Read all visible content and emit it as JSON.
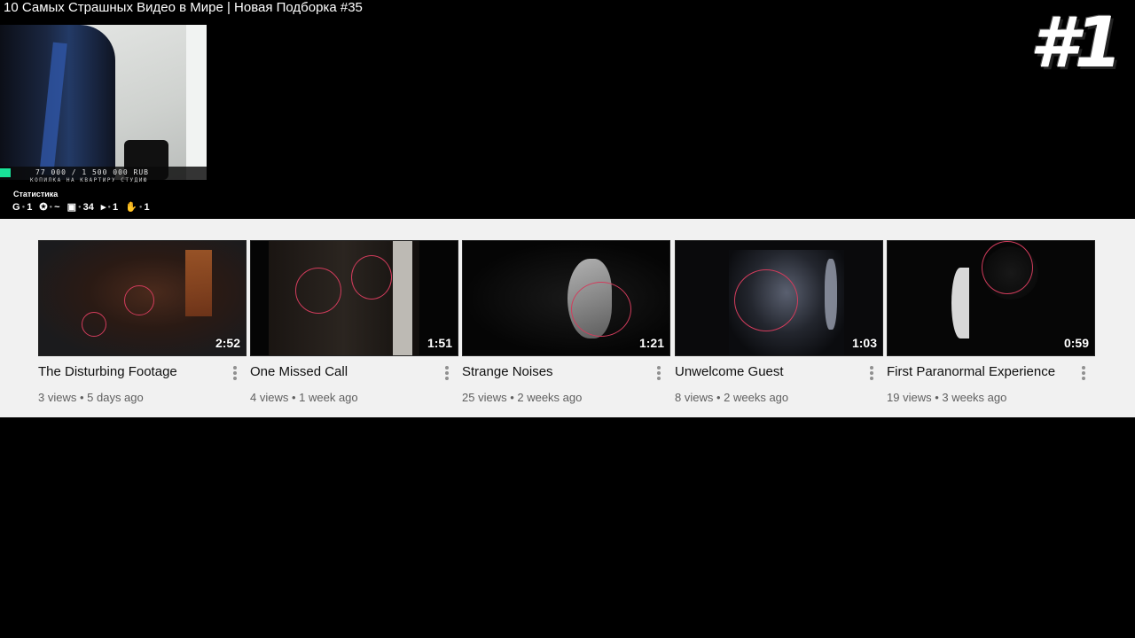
{
  "video": {
    "title": "10 Самых Страшных Видео в Мире | Новая Подборка #35",
    "rank_badge": "#1"
  },
  "stream_overlay": {
    "donation_goal": "77 000 / 1 500 000 RUB",
    "donation_caption": "КОПИЛКА НА КВАРТИРУ СТУДИЮ",
    "donation_progress": 0.051,
    "stats_title": "Статистика",
    "stats": [
      {
        "icon": "g-icon",
        "glyph": "G",
        "value": "1"
      },
      {
        "icon": "gear-icon",
        "glyph": "✪",
        "value": "~"
      },
      {
        "icon": "twitch-icon",
        "glyph": "▣",
        "value": "34"
      },
      {
        "icon": "play-icon",
        "glyph": "▸",
        "value": "1"
      },
      {
        "icon": "hand-icon",
        "glyph": "✋",
        "value": "1"
      }
    ]
  },
  "endscreen": {
    "cards": [
      {
        "title": "The Disturbing Footage",
        "views": "3 views",
        "age": "5 days ago",
        "duration": "2:52"
      },
      {
        "title": "One Missed Call",
        "views": "4 views",
        "age": "1 week ago",
        "duration": "1:51"
      },
      {
        "title": "Strange Noises",
        "views": "25 views",
        "age": "2 weeks ago",
        "duration": "1:21"
      },
      {
        "title": "Unwelcome Guest",
        "views": "8 views",
        "age": "2 weeks ago",
        "duration": "1:03"
      },
      {
        "title": "First Paranormal Experience",
        "views": "19 views",
        "age": "3 weeks ago",
        "duration": "0:59"
      }
    ],
    "meta_separator": " • "
  },
  "colors": {
    "accent_circle": "#d23c5c",
    "donation_fill": "#19e39a",
    "endscreen_bg": "#f1f1f1"
  }
}
